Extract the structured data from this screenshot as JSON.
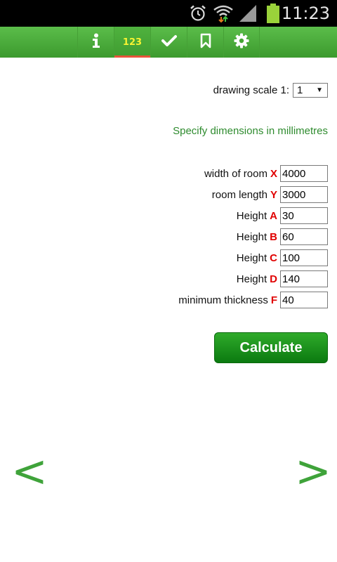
{
  "status_bar": {
    "time": "11:23",
    "icons": [
      "alarm-clock-icon",
      "wifi-icon",
      "cell-signal-icon",
      "battery-icon"
    ]
  },
  "toolbar": {
    "tabs": [
      {
        "id": "info",
        "icon": "info-icon",
        "label": ""
      },
      {
        "id": "input",
        "icon": "",
        "label": "123",
        "active": true
      },
      {
        "id": "check",
        "icon": "checkmark-icon",
        "label": ""
      },
      {
        "id": "bookmark",
        "icon": "bookmark-icon",
        "label": ""
      },
      {
        "id": "settings",
        "icon": "gear-icon",
        "label": ""
      }
    ],
    "colors": {
      "bar": "#4aad3a",
      "active_underline": "#e8533b",
      "active_text": "#f7f332"
    }
  },
  "scale": {
    "label": "drawing scale 1:",
    "value": "1"
  },
  "hint": "Specify dimensions in millimetres",
  "fields": [
    {
      "label": "width of room",
      "letter": "X",
      "value": "4000"
    },
    {
      "label": "room length",
      "letter": "Y",
      "value": "3000"
    },
    {
      "label": "Height",
      "letter": "A",
      "value": "30"
    },
    {
      "label": "Height",
      "letter": "B",
      "value": "60"
    },
    {
      "label": "Height",
      "letter": "C",
      "value": "100"
    },
    {
      "label": "Height",
      "letter": "D",
      "value": "140"
    },
    {
      "label": "minimum thickness",
      "letter": "F",
      "value": "40"
    }
  ],
  "calculate_label": "Calculate",
  "nav": {
    "prev": "<",
    "next": ">"
  },
  "colors": {
    "letter": "#e00000",
    "hint": "#2e8b2e",
    "button": "#1a8f1d",
    "arrow": "#3fa33a"
  }
}
